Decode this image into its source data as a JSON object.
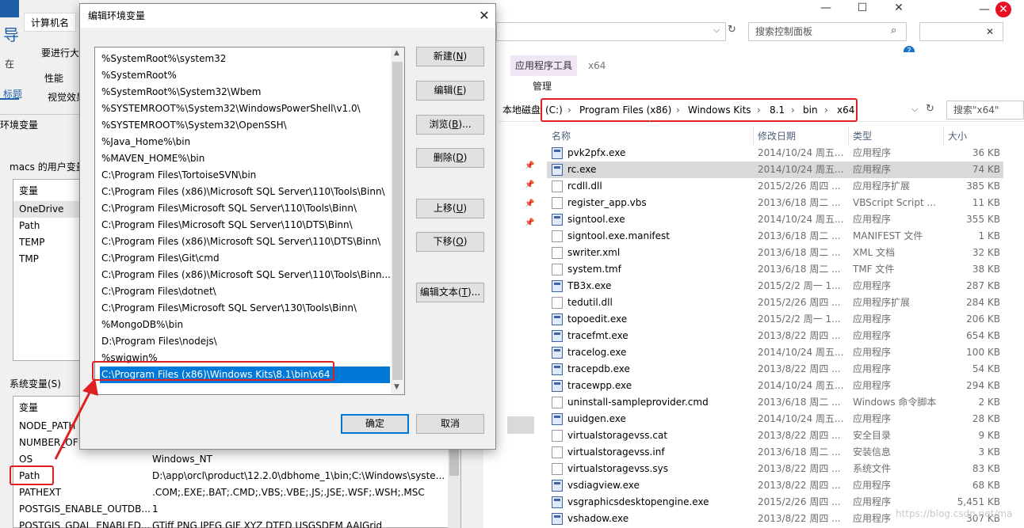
{
  "control_panel": {
    "search_placeholder": "搜索控制面板",
    "minimize": "—",
    "maximize": "☐",
    "close": "✕"
  },
  "system_properties": {
    "tabs": [
      "计算机名"
    ],
    "nav_glyph": "导",
    "search_short": "在",
    "title_short": "标题",
    "labels": {
      "admin_hint": "要进行大",
      "performance": "性能",
      "visual": "视觉效果"
    }
  },
  "env_vars": {
    "title": "环境变量",
    "user_group": "macs 的用户变量",
    "system_group": "系统变量(S)",
    "col_variable": "变量",
    "user_vars": [
      "OneDrive",
      "Path",
      "TEMP",
      "TMP"
    ],
    "system_vars": [
      {
        "name": "NODE_PATH",
        "value": ""
      },
      {
        "name": "NUMBER_OF",
        "value": ""
      },
      {
        "name": "OS",
        "value": "Windows_NT"
      },
      {
        "name": "Path",
        "value": "D:\\app\\orcl\\product\\12.2.0\\dbhome_1\\bin;C:\\Windows\\syste..."
      },
      {
        "name": "PATHEXT",
        "value": ".COM;.EXE;.BAT;.CMD;.VBS;.VBE;.JS;.JSE;.WSF;.WSH;.MSC"
      },
      {
        "name": "POSTGIS_ENABLE_OUTDB...",
        "value": "1"
      },
      {
        "name": "POSTGIS_GDAL_ENABLED...",
        "value": "GTiff PNG JPEG GIF XYZ DTED USGSDEM AAIGrid"
      }
    ]
  },
  "dialog": {
    "title": "编辑环境变量",
    "close": "✕",
    "paths": [
      "%SystemRoot%\\system32",
      "%SystemRoot%",
      "%SystemRoot%\\System32\\Wbem",
      "%SYSTEMROOT%\\System32\\WindowsPowerShell\\v1.0\\",
      "%SYSTEMROOT%\\System32\\OpenSSH\\",
      "%Java_Home%\\bin",
      "%MAVEN_HOME%\\bin",
      "C:\\Program Files\\TortoiseSVN\\bin",
      "C:\\Program Files (x86)\\Microsoft SQL Server\\110\\Tools\\Binn\\",
      "C:\\Program Files\\Microsoft SQL Server\\110\\Tools\\Binn\\",
      "C:\\Program Files\\Microsoft SQL Server\\110\\DTS\\Binn\\",
      "C:\\Program Files (x86)\\Microsoft SQL Server\\110\\DTS\\Binn\\",
      "C:\\Program Files\\Git\\cmd",
      "C:\\Program Files (x86)\\Microsoft SQL Server\\110\\Tools\\Binn...",
      "C:\\Program Files\\dotnet\\",
      "C:\\Program Files\\Microsoft SQL Server\\130\\Tools\\Binn\\",
      "%MongoDB%\\bin",
      "D:\\Program Files\\nodejs\\",
      "%swigwin%",
      "C:\\Program Files (x86)\\Windows Kits\\8.1\\bin\\x64"
    ],
    "selected_index": 19,
    "buttons": {
      "new": "新建(",
      "new_key": "N",
      "edit": "编辑(",
      "edit_key": "E",
      "browse": "浏览(",
      "browse_key": "B",
      "browse_tail": ")...",
      "delete": "删除(",
      "delete_key": "D",
      "up": "上移(",
      "up_key": "U",
      "down": "下移(",
      "down_key": "O",
      "edit_text": "编辑文本(",
      "edit_text_key": "T",
      "edit_text_tail": ")...",
      "close_paren": ")",
      "ok": "确定",
      "cancel": "取消"
    }
  },
  "explorer": {
    "ribbon_tools": "应用程序工具",
    "ribbon_context": "x64",
    "ribbon_manage": "管理",
    "left_label": "本地磁盘",
    "breadcrumb": [
      "(C:)",
      "Program Files (x86)",
      "Windows Kits",
      "8.1",
      "bin",
      "x64"
    ],
    "search_placeholder": "搜索\"x64\"",
    "columns": {
      "name": "名称",
      "date": "修改日期",
      "type": "类型",
      "size": "大小"
    },
    "files": [
      {
        "name": "pvk2pfx.exe",
        "date": "2014/10/24 周五...",
        "type": "应用程序",
        "size": "36 KB",
        "kind": "app"
      },
      {
        "name": "rc.exe",
        "date": "2014/10/24 周五...",
        "type": "应用程序",
        "size": "74 KB",
        "kind": "app"
      },
      {
        "name": "rcdll.dll",
        "date": "2015/2/26 周四 ...",
        "type": "应用程序扩展",
        "size": "385 KB",
        "kind": "doc"
      },
      {
        "name": "register_app.vbs",
        "date": "2013/6/18 周二 ...",
        "type": "VBScript Script ...",
        "size": "11 KB",
        "kind": "doc"
      },
      {
        "name": "signtool.exe",
        "date": "2014/10/24 周五...",
        "type": "应用程序",
        "size": "355 KB",
        "kind": "app"
      },
      {
        "name": "signtool.exe.manifest",
        "date": "2013/6/18 周二 ...",
        "type": "MANIFEST 文件",
        "size": "1 KB",
        "kind": "doc"
      },
      {
        "name": "swriter.xml",
        "date": "2013/6/18 周二 ...",
        "type": "XML 文档",
        "size": "32 KB",
        "kind": "doc"
      },
      {
        "name": "system.tmf",
        "date": "2013/6/18 周二 ...",
        "type": "TMF 文件",
        "size": "38 KB",
        "kind": "doc"
      },
      {
        "name": "TB3x.exe",
        "date": "2015/2/2 周一 1...",
        "type": "应用程序",
        "size": "287 KB",
        "kind": "app"
      },
      {
        "name": "tedutil.dll",
        "date": "2015/2/26 周四 ...",
        "type": "应用程序扩展",
        "size": "284 KB",
        "kind": "doc"
      },
      {
        "name": "topoedit.exe",
        "date": "2015/2/2 周一 1...",
        "type": "应用程序",
        "size": "206 KB",
        "kind": "app"
      },
      {
        "name": "tracefmt.exe",
        "date": "2013/8/22 周四 ...",
        "type": "应用程序",
        "size": "654 KB",
        "kind": "app"
      },
      {
        "name": "tracelog.exe",
        "date": "2014/10/24 周五...",
        "type": "应用程序",
        "size": "100 KB",
        "kind": "app"
      },
      {
        "name": "tracepdb.exe",
        "date": "2013/8/22 周四 ...",
        "type": "应用程序",
        "size": "54 KB",
        "kind": "app"
      },
      {
        "name": "tracewpp.exe",
        "date": "2014/10/24 周五...",
        "type": "应用程序",
        "size": "294 KB",
        "kind": "app"
      },
      {
        "name": "uninstall-sampleprovider.cmd",
        "date": "2013/6/18 周二 ...",
        "type": "Windows 命令脚本",
        "size": "2 KB",
        "kind": "doc"
      },
      {
        "name": "uuidgen.exe",
        "date": "2014/10/24 周五...",
        "type": "应用程序",
        "size": "28 KB",
        "kind": "app"
      },
      {
        "name": "virtualstoragevss.cat",
        "date": "2013/8/22 周四 ...",
        "type": "安全目录",
        "size": "9 KB",
        "kind": "doc"
      },
      {
        "name": "virtualstoragevss.inf",
        "date": "2013/6/18 周二 ...",
        "type": "安装信息",
        "size": "3 KB",
        "kind": "doc"
      },
      {
        "name": "virtualstoragevss.sys",
        "date": "2013/8/22 周四 ...",
        "type": "系统文件",
        "size": "83 KB",
        "kind": "doc"
      },
      {
        "name": "vsdiagview.exe",
        "date": "2013/8/22 周四 ...",
        "type": "应用程序",
        "size": "68 KB",
        "kind": "app"
      },
      {
        "name": "vsgraphicsdesktopengine.exe",
        "date": "2015/2/26 周四 ...",
        "type": "应用程序",
        "size": "5,451 KB",
        "kind": "app"
      },
      {
        "name": "vshadow.exe",
        "date": "2013/8/22 周四 ...",
        "type": "应用程序",
        "size": "307 KB",
        "kind": "app"
      }
    ],
    "selected_index": 1
  },
  "watermark": "https://blog.csdn.net/ma",
  "colors": {
    "accent": "#0078d7",
    "highlight": "#e02020",
    "ribbon_tools_bg": "#f0e6f6"
  }
}
